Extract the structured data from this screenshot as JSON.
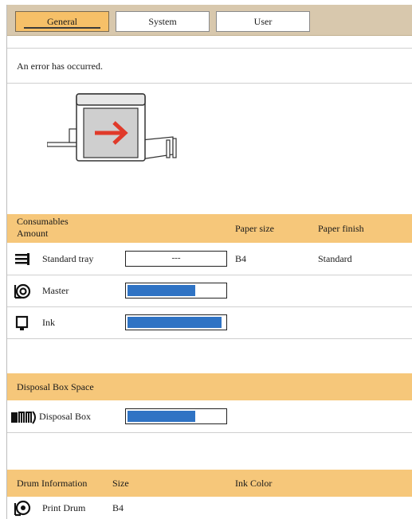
{
  "tabs": {
    "general": "General",
    "system": "System",
    "user": "User"
  },
  "message": "An error has occurred.",
  "consumables": {
    "header_line1": "Consumables",
    "header_line2": "Amount",
    "col_paper_size": "Paper size",
    "col_paper_finish": "Paper finish",
    "tray_label": "Standard tray",
    "tray_amount": "---",
    "tray_paper_size": "B4",
    "tray_paper_finish": "Standard",
    "master_label": "Master",
    "master_level": 0.7,
    "ink_label": "Ink",
    "ink_level": 0.97
  },
  "disposal": {
    "header": "Disposal Box Space",
    "box_label": "Disposal Box",
    "box_level": 0.7
  },
  "drum": {
    "header": "Drum Information",
    "col_size": "Size",
    "col_ink_color": "Ink Color",
    "drum_label": "Print Drum",
    "drum_size": "B4"
  },
  "colors": {
    "accent": "#f6c77a",
    "active_tab": "#f6c068",
    "bar_fill": "#2f73c4",
    "arrow": "#e03a2a"
  }
}
